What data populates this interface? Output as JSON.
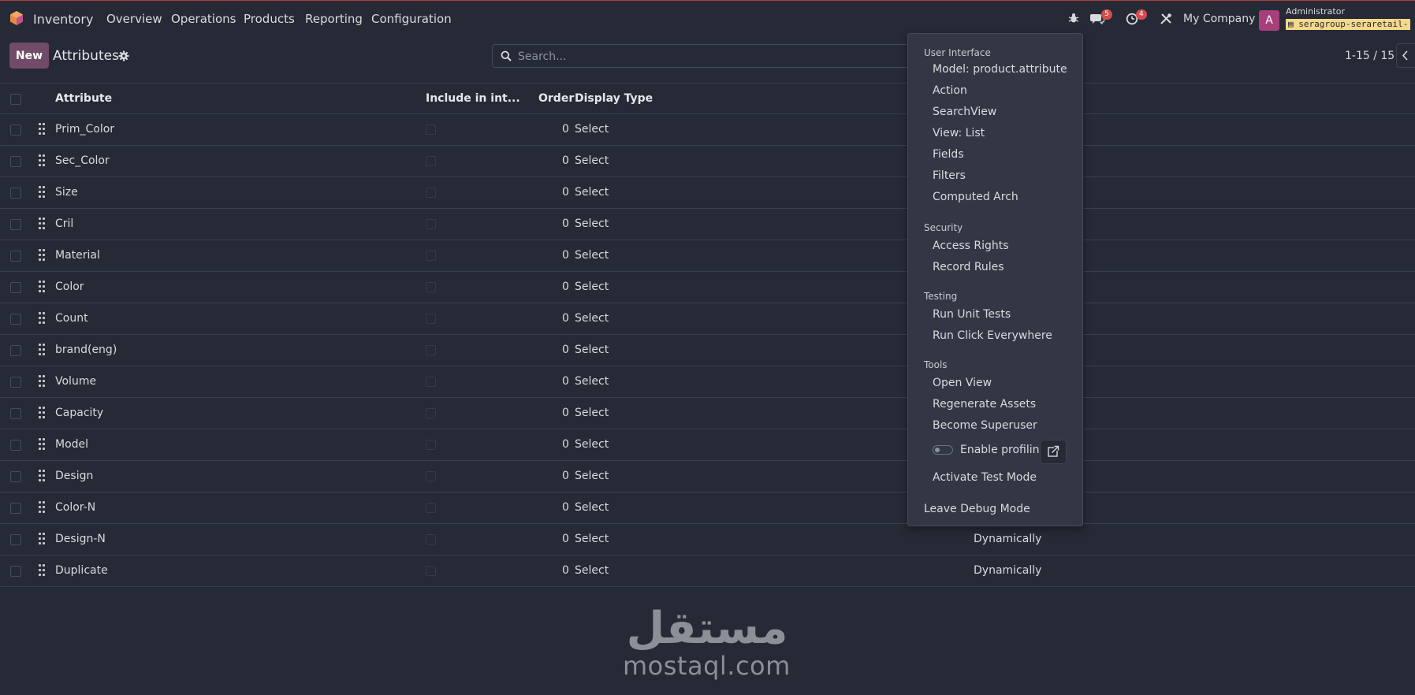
{
  "nav": {
    "app_name": "Inventory",
    "items": [
      "Overview",
      "Operations",
      "Products",
      "Reporting",
      "Configuration"
    ],
    "messages_count": "5",
    "activities_count": "4",
    "company": "My Company",
    "avatar_letter": "A",
    "user_name": "Administrator",
    "database": "seraretail-"
  },
  "control": {
    "new_label": "New",
    "breadcrumb": "Attributes",
    "search_placeholder": "Search...",
    "pager": "1-15 / 15"
  },
  "table": {
    "headers": {
      "attribute": "Attribute",
      "include": "Include in int...",
      "order": "Order",
      "display_type": "Display Type"
    },
    "rows": [
      {
        "name": "Prim_Color",
        "order": "0",
        "display": "Select",
        "variant": ""
      },
      {
        "name": "Sec_Color",
        "order": "0",
        "display": "Select",
        "variant": ""
      },
      {
        "name": "Size",
        "order": "0",
        "display": "Select",
        "variant": ""
      },
      {
        "name": "Cril",
        "order": "0",
        "display": "Select",
        "variant": ""
      },
      {
        "name": "Material",
        "order": "0",
        "display": "Select",
        "variant": ""
      },
      {
        "name": "Color",
        "order": "0",
        "display": "Select",
        "variant": ""
      },
      {
        "name": "Count",
        "order": "0",
        "display": "Select",
        "variant": ""
      },
      {
        "name": "brand(eng)",
        "order": "0",
        "display": "Select",
        "variant": ""
      },
      {
        "name": "Volume",
        "order": "0",
        "display": "Select",
        "variant": ""
      },
      {
        "name": "Capacity",
        "order": "0",
        "display": "Select",
        "variant": ""
      },
      {
        "name": "Model",
        "order": "0",
        "display": "Select",
        "variant": ""
      },
      {
        "name": "Design",
        "order": "0",
        "display": "Select",
        "variant": ""
      },
      {
        "name": "Color-N",
        "order": "0",
        "display": "Select",
        "variant": ""
      },
      {
        "name": "Design-N",
        "order": "0",
        "display": "Select",
        "variant": "Dynamically"
      },
      {
        "name": "Duplicate",
        "order": "0",
        "display": "Select",
        "variant": "Dynamically"
      }
    ]
  },
  "debug_menu": {
    "sections": [
      {
        "title": "User Interface",
        "items": [
          "Model: product.attribute",
          "Action",
          "SearchView",
          "View: List",
          "Fields",
          "Filters",
          "Computed Arch"
        ]
      },
      {
        "title": "Security",
        "items": [
          "Access Rights",
          "Record Rules"
        ]
      },
      {
        "title": "Testing",
        "items": [
          "Run Unit Tests",
          "Run Click Everywhere"
        ]
      },
      {
        "title": "Tools",
        "items": [
          "Open View",
          "Regenerate Assets",
          "Become Superuser"
        ]
      }
    ],
    "profiling_label": "Enable profiling",
    "test_mode": "Activate Test Mode",
    "leave_debug": "Leave Debug Mode"
  },
  "watermark": {
    "arabic": "مستقل",
    "latin": "mostaql.com"
  },
  "colors": {
    "background": "#262a36",
    "primary": "#714b67",
    "badge": "#d44c4c",
    "avatar": "#a63f7b",
    "db_tag": "#f5d98a"
  }
}
